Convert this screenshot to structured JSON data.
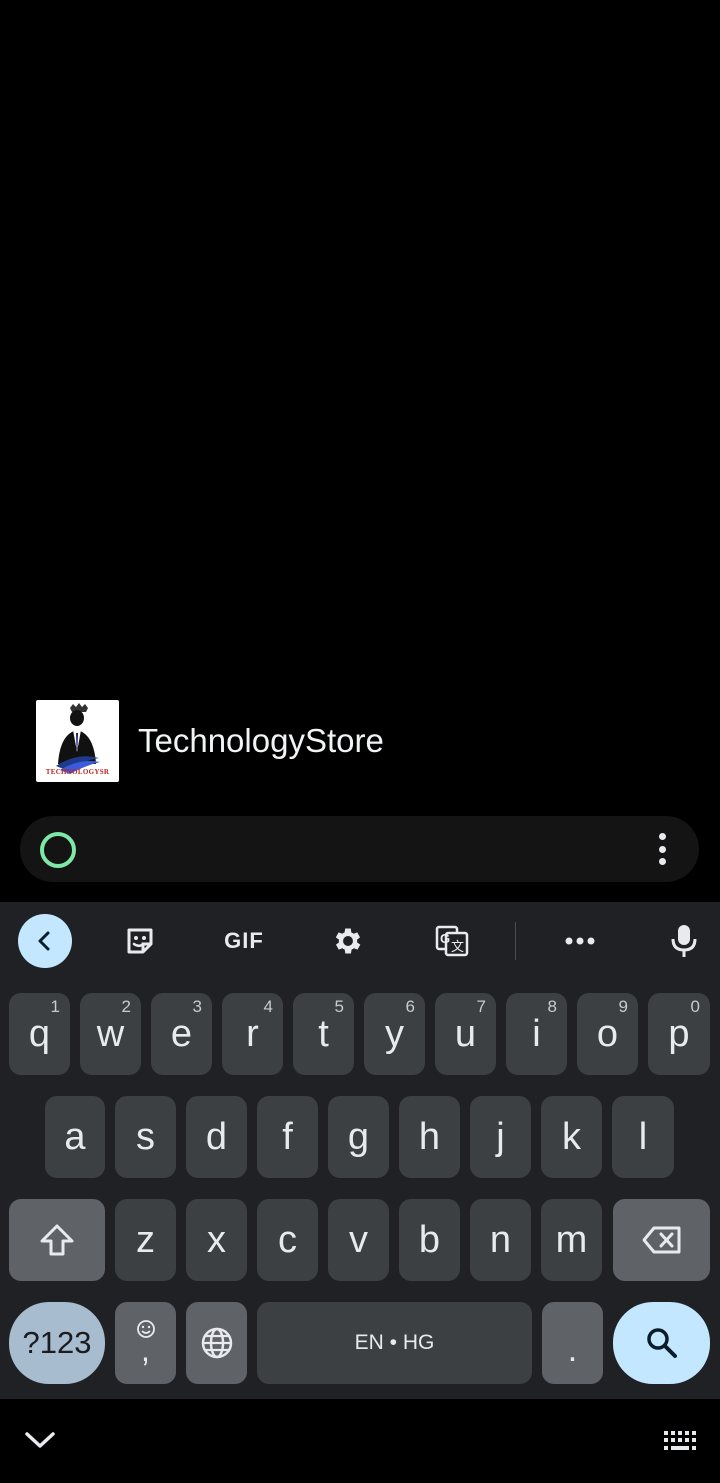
{
  "app": {
    "name": "TechnologyStore",
    "logo_text": "TECHNOLOGYSR"
  },
  "search": {
    "value": "",
    "placeholder": ""
  },
  "toolbar": {
    "items": [
      "back-icon",
      "sticker-icon",
      "gif",
      "settings-icon",
      "translate-icon",
      "more-icon",
      "mic-icon"
    ],
    "gif_label": "GIF"
  },
  "keyboard": {
    "row1": [
      {
        "k": "q",
        "h": "1"
      },
      {
        "k": "w",
        "h": "2"
      },
      {
        "k": "e",
        "h": "3"
      },
      {
        "k": "r",
        "h": "4"
      },
      {
        "k": "t",
        "h": "5"
      },
      {
        "k": "y",
        "h": "6"
      },
      {
        "k": "u",
        "h": "7"
      },
      {
        "k": "i",
        "h": "8"
      },
      {
        "k": "o",
        "h": "9"
      },
      {
        "k": "p",
        "h": "0"
      }
    ],
    "row2": [
      "a",
      "s",
      "d",
      "f",
      "g",
      "h",
      "j",
      "k",
      "l"
    ],
    "row3": [
      "z",
      "x",
      "c",
      "v",
      "b",
      "n",
      "m"
    ],
    "symbols_label": "?123",
    "comma_label": ",",
    "space_label": "EN • HG",
    "period_label": ".",
    "accent_color": "#c2e7ff"
  }
}
